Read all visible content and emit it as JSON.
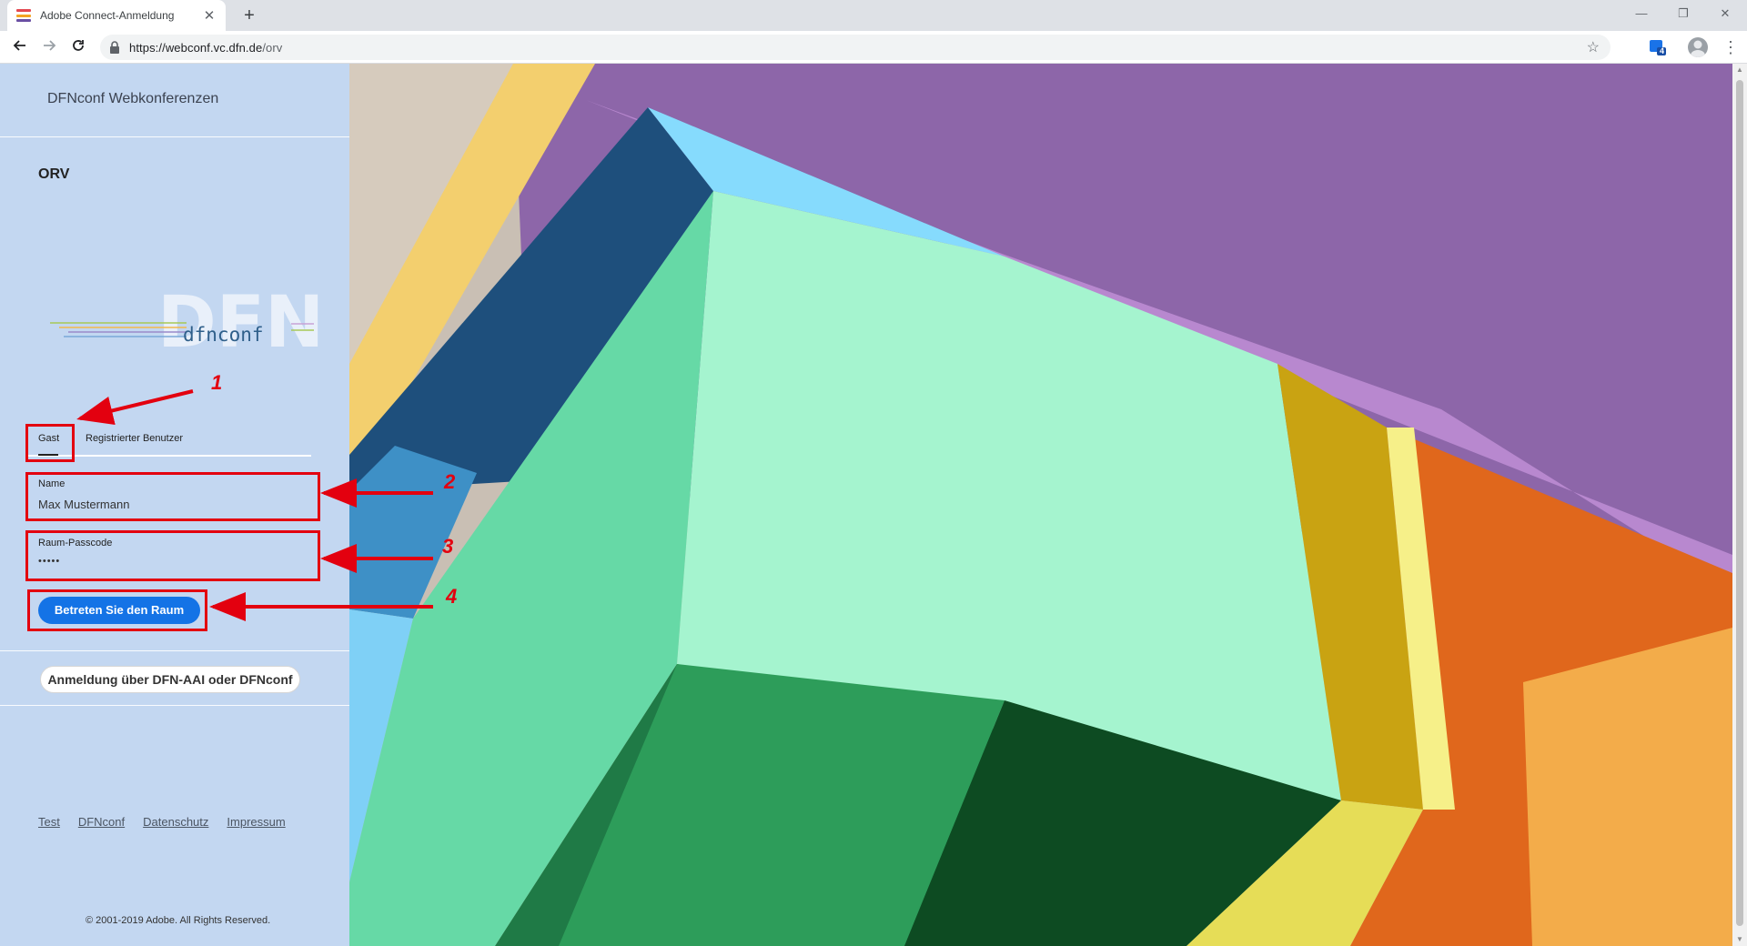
{
  "browser": {
    "tab_title": "Adobe Connect-Anmeldung",
    "tab_close": "✕",
    "new_tab": "+",
    "url_main": "https://webconf.vc.dfn.de",
    "url_path": "/orv",
    "back_icon": "arrow-left-icon",
    "forward_icon": "arrow-right-icon",
    "reload_icon": "reload-icon",
    "extension_badge": "4"
  },
  "sidebar": {
    "brand": "DFNconf Webkonferenzen",
    "room_name": "ORV",
    "logo_big": "DFN",
    "logo_small": "dfnconf",
    "tabs": {
      "guest": "Gast",
      "registered": "Registrierter Benutzer"
    },
    "name_field": {
      "label": "Name",
      "value": "Max Mustermann"
    },
    "passcode_field": {
      "label": "Raum-Passcode",
      "value": "•••••"
    },
    "enter_button": "Betreten Sie den Raum",
    "aai_button": "Anmeldung über DFN-AAI oder DFNconf",
    "footer_links": [
      "Test",
      "DFNconf",
      "Datenschutz",
      "Impressum"
    ],
    "copyright": "© 2001-2019 Adobe. All Rights Reserved."
  },
  "annotations": [
    "1",
    "2",
    "3",
    "4"
  ],
  "colors": {
    "sidebar_bg": "#c3d7f1",
    "primary_button": "#1473e6",
    "annotation_red": "#e3000f"
  }
}
